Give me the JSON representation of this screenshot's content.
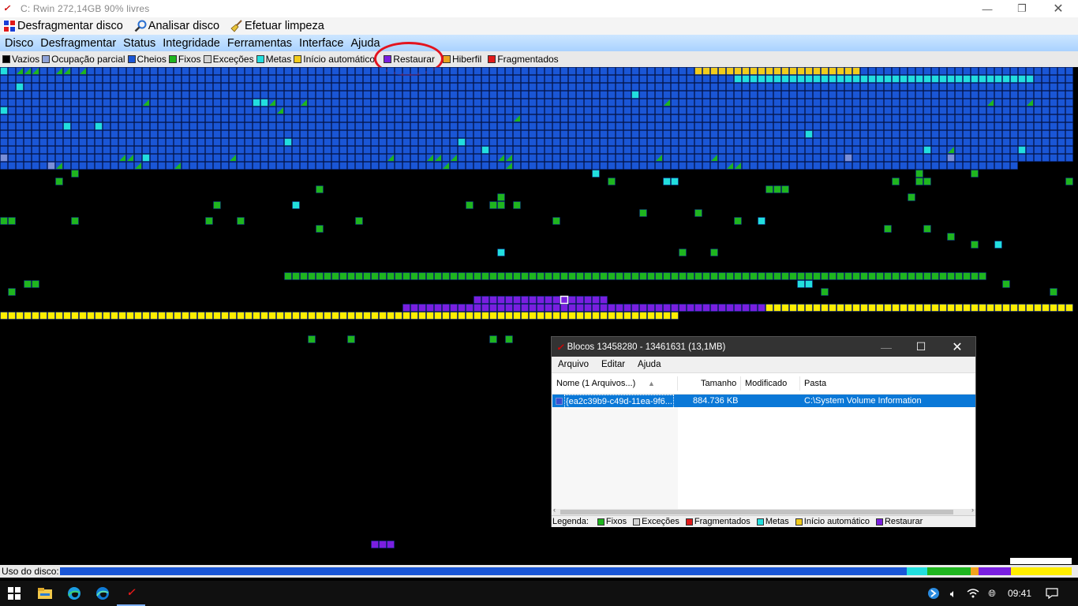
{
  "window": {
    "title": "C: Rwin  272,14GB 90% livres",
    "controls": [
      "minimize-icon",
      "restore-icon",
      "close-icon"
    ]
  },
  "toolbar": {
    "defrag": "Desfragmentar disco",
    "analyze": "Analisar disco",
    "cleanup": "Efetuar limpeza"
  },
  "menu": [
    "Disco",
    "Desfragmentar",
    "Status",
    "Integridade",
    "Ferramentas",
    "Interface",
    "Ajuda"
  ],
  "legend": [
    {
      "label": "Vazios",
      "color": "#000000"
    },
    {
      "label": "Ocupação parcial",
      "color": "#8ea2d8"
    },
    {
      "label": "Cheios",
      "color": "#1a56d6"
    },
    {
      "label": "Fixos",
      "color": "#1fb51f"
    },
    {
      "label": "Exceções",
      "color": "#d4d4d4"
    },
    {
      "label": "Metas",
      "color": "#22dede"
    },
    {
      "label": "Início automático",
      "color": "#f2cc1c"
    },
    {
      "label": "Restaurar",
      "color": "#7a1fe0"
    },
    {
      "label": "Hiberfil",
      "color": "#e8a41c"
    },
    {
      "label": "Fragmentados",
      "color": "#e11a1a"
    }
  ],
  "map_colors": {
    "full": "#1a56d6",
    "fixed": "#1fb51f",
    "meta": "#22dede",
    "autostart": "#f2cc1c",
    "restore": "#7a1fe0",
    "partial": "#7a8fd8",
    "yellow": "#ffee00"
  },
  "usage": {
    "label": "Uso do disco:",
    "segments": [
      {
        "color": "#1a56d6",
        "fraction": 0.837
      },
      {
        "color": "#22dede",
        "fraction": 0.02
      },
      {
        "color": "#1fb51f",
        "fraction": 0.043
      },
      {
        "color": "#f2a21c",
        "fraction": 0.008
      },
      {
        "color": "#7a1fe0",
        "fraction": 0.032
      },
      {
        "color": "#ffee00",
        "fraction": 0.06
      }
    ]
  },
  "blocks_window": {
    "title": "Blocos 13458280 - 13461631  (13,1MB)",
    "menu": [
      "Arquivo",
      "Editar",
      "Ajuda"
    ],
    "columns": {
      "name": "Nome  (1 Arquivos...)",
      "size": "Tamanho",
      "modified": "Modificado",
      "folder": "Pasta"
    },
    "rows": [
      {
        "name": "{ea2c39b9-c49d-11ea-9f6...",
        "size": "884.736 KB",
        "modified": "",
        "folder": "C:\\System Volume Information"
      }
    ],
    "legend_label": "Legenda:",
    "legend": [
      {
        "label": "Fixos",
        "color": "#1fb51f"
      },
      {
        "label": "Exceções",
        "color": "#d4d4d4"
      },
      {
        "label": "Fragmentados",
        "color": "#e11a1a"
      },
      {
        "label": "Metas",
        "color": "#22dede"
      },
      {
        "label": "Início automático",
        "color": "#f2cc1c"
      },
      {
        "label": "Restaurar",
        "color": "#7a1fe0"
      }
    ]
  },
  "taskbar": {
    "clock": "09:41",
    "icons": [
      "windows-start-icon",
      "file-explorer-icon",
      "edge-icon",
      "edge-beta-icon",
      "rwin-app-icon"
    ],
    "tray": [
      "network-icon",
      "volume-icon",
      "wifi-icon",
      "notification-icon"
    ]
  }
}
